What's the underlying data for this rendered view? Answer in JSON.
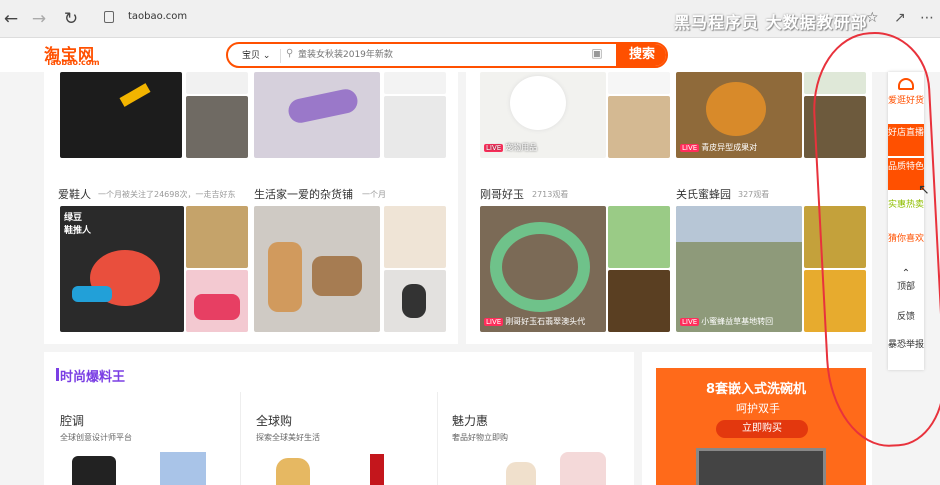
{
  "browser": {
    "url": "taobao.com",
    "watermark": "黑马程序员 大数据教研部"
  },
  "header": {
    "logo_cn": "淘宝网",
    "logo_en": "Taobao.com",
    "search_type": "宝贝",
    "search_placeholder": "童装女秋装2019年新款",
    "search_button": "搜索"
  },
  "left_cards": [
    {
      "title": "爱鞋人",
      "subtitle": "一个月被关注了24698次，一走吉好东",
      "tag": "绿豆 鞋推人"
    },
    {
      "title": "生活家一爱的杂货铺",
      "subtitle": "一个月"
    }
  ],
  "live_cards": [
    {
      "label": "宠物用品"
    },
    {
      "label": "青皮异型成果对"
    },
    {
      "title": "刚哥好玉",
      "watch": "2713观看",
      "label": "刚哥好玉石翡翠澳头代"
    },
    {
      "title": "关氏蜜蜂园",
      "watch": "327观看",
      "label": "小蜜蜂益草基地转回"
    }
  ],
  "live_tag": "LIVE",
  "fashion": {
    "title": "时尚爆料王",
    "columns": [
      {
        "title": "腔调",
        "subtitle": "全球创意设计师平台"
      },
      {
        "title": "全球购",
        "subtitle": "探索全球美好生活"
      },
      {
        "title": "魅力惠",
        "subtitle": "奢品好物立即购"
      }
    ]
  },
  "ad": {
    "line1": "8套嵌入式洗碗机",
    "line2": "呵护双手",
    "button": "立即购买"
  },
  "sidebar": {
    "items": [
      {
        "label": "爱逛好货",
        "color": "#ff5000"
      },
      {
        "label": "好店直播",
        "color": "#ffffff",
        "active": true
      },
      {
        "label": "品质特色",
        "color": "#ffffff",
        "active": true
      },
      {
        "label": "实惠热卖",
        "color": "#8fbf00"
      },
      {
        "label": "猜你喜欢",
        "color": "#ff5000"
      },
      {
        "label": "顶部",
        "color": "#333333"
      },
      {
        "label": "反馈",
        "color": "#333333"
      },
      {
        "label": "暴恐举报",
        "color": "#333333"
      }
    ]
  }
}
